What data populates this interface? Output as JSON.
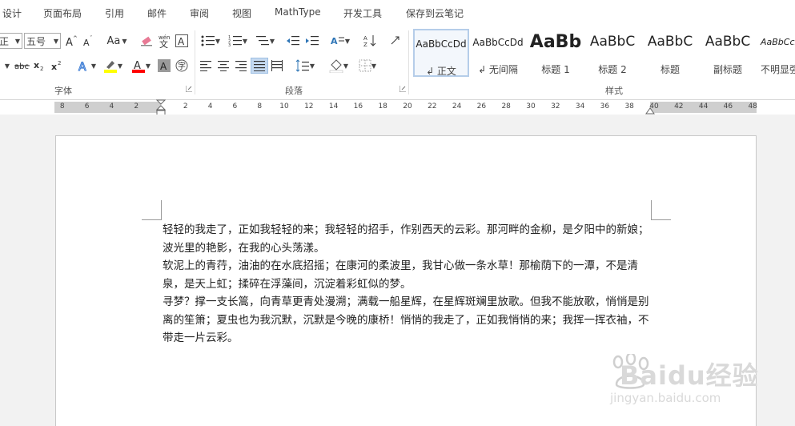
{
  "menu": {
    "tabs": [
      "设计",
      "页面布局",
      "引用",
      "邮件",
      "审阅",
      "视图",
      "MathType",
      "开发工具",
      "保存到云笔记"
    ]
  },
  "font": {
    "name_value": "正",
    "size_value": "五号",
    "case_label": "Aa",
    "group_label": "字体"
  },
  "paragraph": {
    "group_label": "段落"
  },
  "styles": {
    "group_label": "样式",
    "items": [
      {
        "preview": "AaBbCcDd",
        "name": "↲ 正文"
      },
      {
        "preview": "AaBbCcDd",
        "name": "↲ 无间隔"
      },
      {
        "preview": "AaBb",
        "name": "标题 1"
      },
      {
        "preview": "AaBbC",
        "name": "标题 2"
      },
      {
        "preview": "AaBbC",
        "name": "标题"
      },
      {
        "preview": "AaBbC",
        "name": "副标题"
      },
      {
        "preview": "AaBbCcDd",
        "name": "不明显强"
      }
    ]
  },
  "ruler": {
    "left_numbers": [
      "8",
      "6",
      "4",
      "2"
    ],
    "right_numbers": [
      "2",
      "4",
      "6",
      "8",
      "10",
      "12",
      "14",
      "16",
      "18",
      "20",
      "22",
      "24",
      "26",
      "28",
      "30",
      "32",
      "34",
      "36",
      "38",
      "40",
      "42",
      "44",
      "46",
      "48"
    ]
  },
  "document": {
    "paragraphs": [
      "轻轻的我走了，正如我轻轻的来；我轻轻的招手，作别西天的云彩。那河畔的金柳，是夕阳中的新娘；波光里的艳影，在我的心头荡漾。",
      "软泥上的青荇，油油的在水底招摇；在康河的柔波里，我甘心做一条水草！那榆荫下的一潭，不是清泉，是天上虹；揉碎在浮藻间，沉淀着彩虹似的梦。",
      "寻梦？撑一支长篙，向青草更青处漫溯；满载一船星辉，在星辉斑斓里放歌。但我不能放歌，悄悄是别离的笙箫；夏虫也为我沉默，沉默是今晚的康桥！悄悄的我走了，正如我悄悄的来；我挥一挥衣袖，不带走一片云彩。"
    ]
  },
  "watermark": {
    "brand": "Baidu经验",
    "url": "jingyan.baidu.com"
  },
  "colors": {
    "highlight": "#ffff00",
    "font_color": "#ff0000",
    "selected_style_border": "#b5cde9"
  }
}
